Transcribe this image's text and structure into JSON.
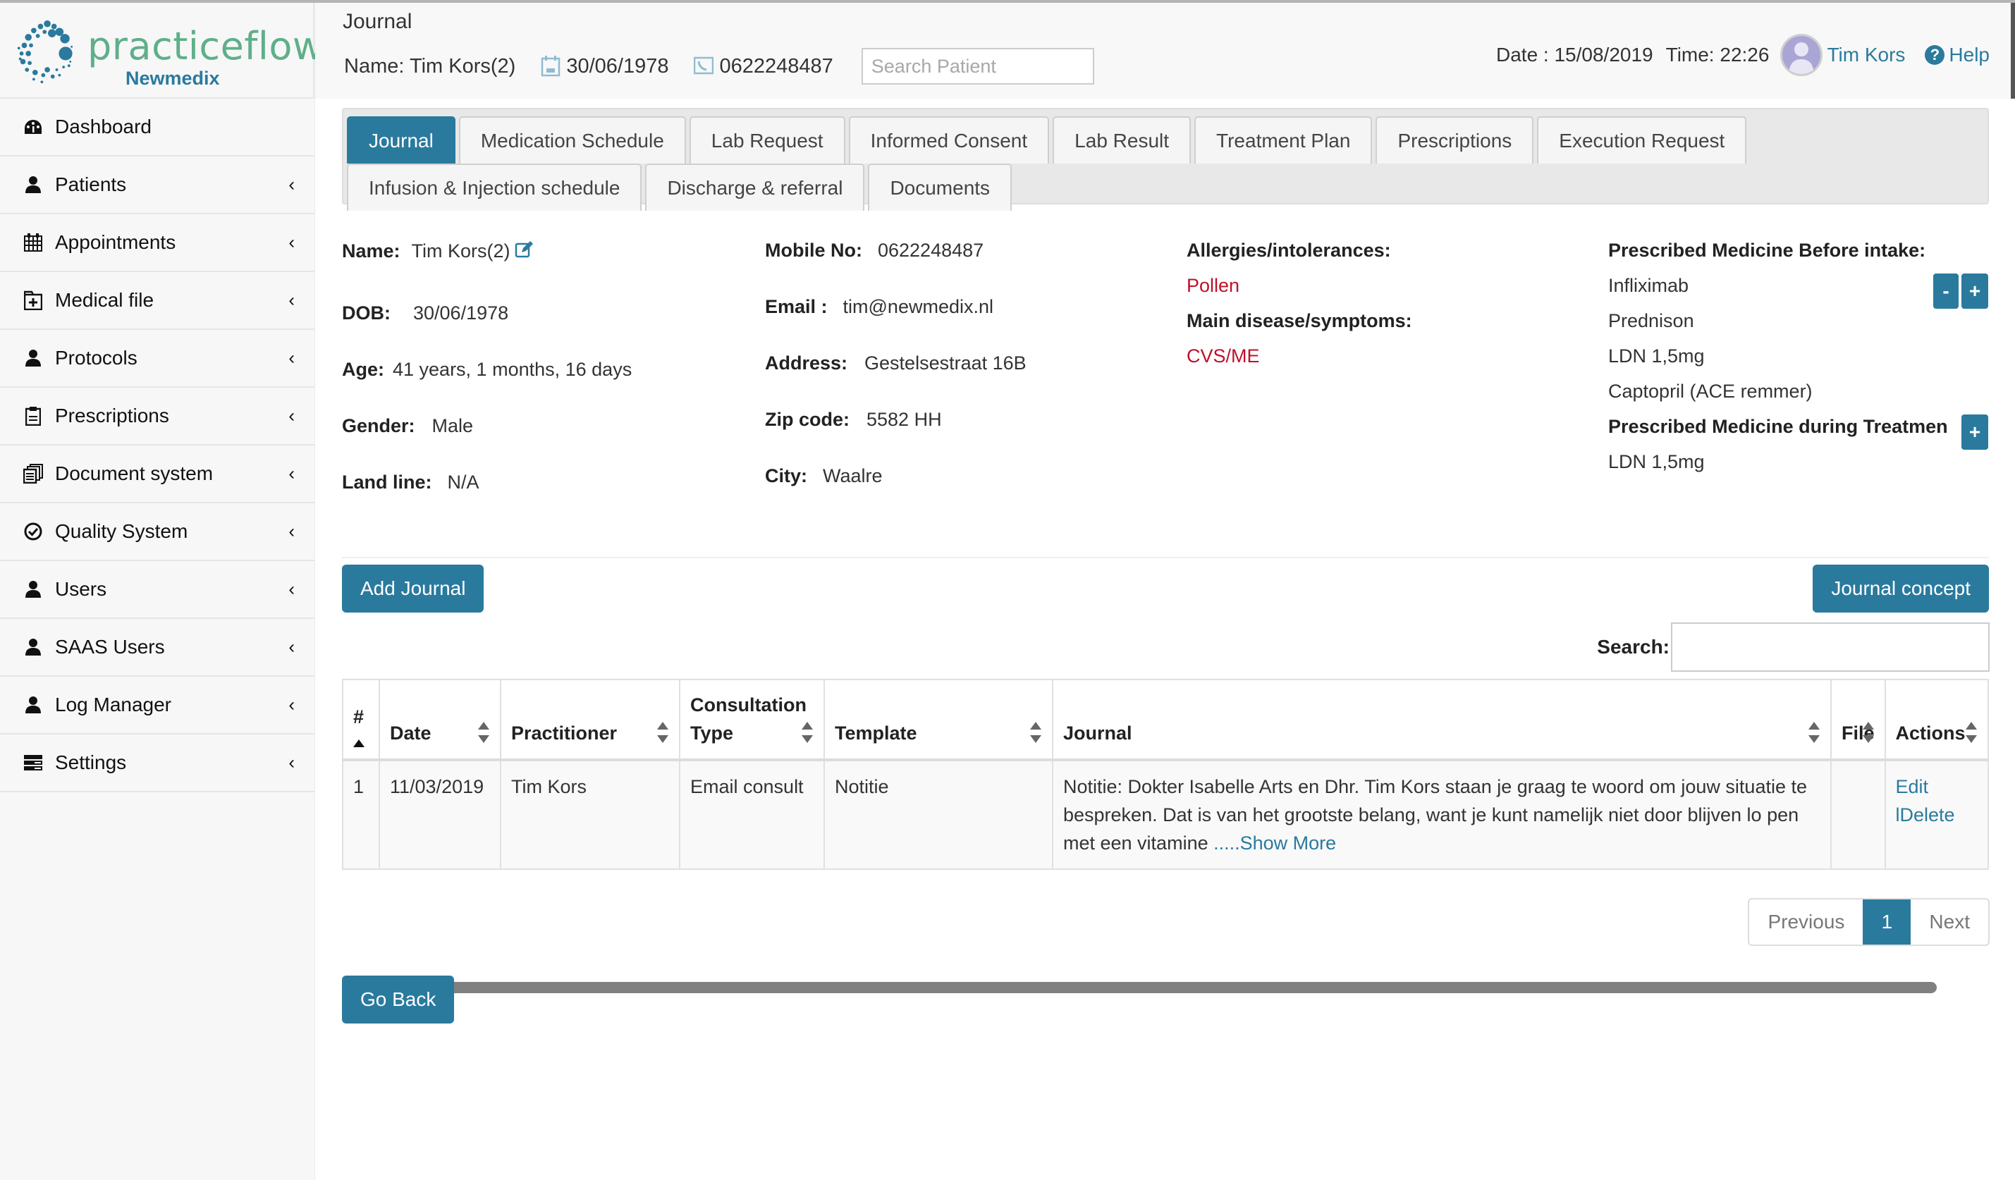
{
  "brand": {
    "name": "practiceflow",
    "subtitle": "Newmedix",
    "accent_color": "#2a7a9e",
    "logo_green": "#5faf8a"
  },
  "sidebar": {
    "items": [
      {
        "label": "Dashboard",
        "icon": "dashboard-icon",
        "expandable": false
      },
      {
        "label": "Patients",
        "icon": "user-icon",
        "expandable": true
      },
      {
        "label": "Appointments",
        "icon": "calendar-icon",
        "expandable": true
      },
      {
        "label": "Medical file",
        "icon": "medical-folder-icon",
        "expandable": true
      },
      {
        "label": "Protocols",
        "icon": "user-icon",
        "expandable": true
      },
      {
        "label": "Prescriptions",
        "icon": "clipboard-icon",
        "expandable": true
      },
      {
        "label": "Document system",
        "icon": "documents-icon",
        "expandable": true
      },
      {
        "label": "Quality System",
        "icon": "check-circle-icon",
        "expandable": true
      },
      {
        "label": "Users",
        "icon": "user-icon",
        "expandable": true
      },
      {
        "label": "SAAS Users",
        "icon": "user-icon",
        "expandable": true
      },
      {
        "label": "Log Manager",
        "icon": "user-icon",
        "expandable": true
      },
      {
        "label": "Settings",
        "icon": "settings-list-icon",
        "expandable": true
      }
    ],
    "chevron": "‹"
  },
  "header": {
    "page_title": "Journal",
    "patient_name": "Name: Tim Kors(2)",
    "patient_dob": "30/06/1978",
    "patient_phone": "0622248487",
    "search_placeholder": "Search Patient",
    "date_text": "Date : 15/08/2019",
    "time_text": "Time: 22:26",
    "user_name": "Tim Kors",
    "help_label": "Help",
    "help_glyph": "?"
  },
  "tabs": {
    "row1": [
      "Journal",
      "Medication Schedule",
      "Lab Request",
      "Informed Consent",
      "Lab Result",
      "Treatment Plan",
      "Prescriptions",
      "Execution Request"
    ],
    "row2": [
      "Infusion & Injection schedule",
      "Discharge & referral",
      "Documents"
    ],
    "active": "Journal"
  },
  "patient": {
    "name_label": "Name:",
    "name": "Tim Kors(2)",
    "dob_label": "DOB:",
    "dob": "30/06/1978",
    "age_label": "Age:",
    "age": "41 years, 1 months, 16 days",
    "gender_label": "Gender:",
    "gender": "Male",
    "landline_label": "Land line:",
    "landline": "N/A",
    "mobile_label": "Mobile No:",
    "mobile": "0622248487",
    "email_label": "Email :",
    "email": "tim@newmedix.nl",
    "address_label": "Address:",
    "address": "Gestelsestraat 16B",
    "zip_label": "Zip code:",
    "zip": "5582 HH",
    "city_label": "City:",
    "city": "Waalre",
    "allergies_label": "Allergies/intolerances:",
    "allergies": "Pollen",
    "disease_label": "Main disease/symptoms:",
    "disease": "CVS/ME",
    "before_intake_label": "Prescribed Medicine Before intake:",
    "before_intake": [
      "Infliximab",
      "Prednison",
      "LDN 1,5mg",
      "Captopril (ACE remmer)"
    ],
    "during_treatment_label": "Prescribed Medicine during Treatmen",
    "during_treatment": [
      "LDN 1,5mg"
    ],
    "minus_label": "-",
    "plus_label": "+"
  },
  "actions": {
    "add_journal": "Add Journal",
    "journal_concept": "Journal concept",
    "search_label": "Search:",
    "search_value": "",
    "go_back": "Go Back"
  },
  "table": {
    "headers": [
      "#",
      "Date",
      "Practitioner",
      "Consultation Type",
      "Template",
      "Journal",
      "File",
      "Actions"
    ],
    "header_consult_line1": "Consultation",
    "header_consult_line2": "Type",
    "rows": [
      {
        "num": "1",
        "date": "11/03/2019",
        "practitioner": "Tim Kors",
        "consultation_type": "Email consult",
        "template": "Notitie",
        "journal": "Notitie: Dokter Isabelle Arts en Dhr. Tim Kors staan je graag te woord om jouw situatie te bespreken. Dat is van het grootste belang, want je kunt namelijk niet door blijven lo pen met een vitamine",
        "show_more": ".....Show More",
        "file": "",
        "edit": "Edit",
        "delete": "lDelete"
      }
    ]
  },
  "pagination": {
    "previous": "Previous",
    "current": "1",
    "next": "Next"
  }
}
